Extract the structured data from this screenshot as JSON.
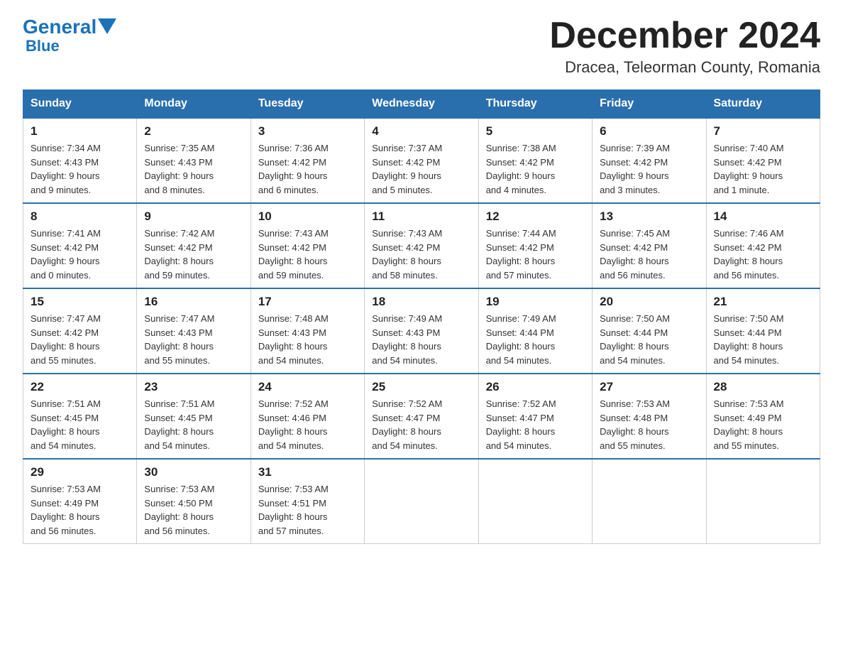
{
  "logo": {
    "general": "General",
    "blue": "Blue",
    "triangle": "▼"
  },
  "header": {
    "title": "December 2024",
    "subtitle": "Dracea, Teleorman County, Romania"
  },
  "days_of_week": [
    "Sunday",
    "Monday",
    "Tuesday",
    "Wednesday",
    "Thursday",
    "Friday",
    "Saturday"
  ],
  "weeks": [
    [
      {
        "day": "1",
        "sunrise": "7:34 AM",
        "sunset": "4:43 PM",
        "daylight": "9 hours and 9 minutes."
      },
      {
        "day": "2",
        "sunrise": "7:35 AM",
        "sunset": "4:43 PM",
        "daylight": "9 hours and 8 minutes."
      },
      {
        "day": "3",
        "sunrise": "7:36 AM",
        "sunset": "4:42 PM",
        "daylight": "9 hours and 6 minutes."
      },
      {
        "day": "4",
        "sunrise": "7:37 AM",
        "sunset": "4:42 PM",
        "daylight": "9 hours and 5 minutes."
      },
      {
        "day": "5",
        "sunrise": "7:38 AM",
        "sunset": "4:42 PM",
        "daylight": "9 hours and 4 minutes."
      },
      {
        "day": "6",
        "sunrise": "7:39 AM",
        "sunset": "4:42 PM",
        "daylight": "9 hours and 3 minutes."
      },
      {
        "day": "7",
        "sunrise": "7:40 AM",
        "sunset": "4:42 PM",
        "daylight": "9 hours and 1 minute."
      }
    ],
    [
      {
        "day": "8",
        "sunrise": "7:41 AM",
        "sunset": "4:42 PM",
        "daylight": "9 hours and 0 minutes."
      },
      {
        "day": "9",
        "sunrise": "7:42 AM",
        "sunset": "4:42 PM",
        "daylight": "8 hours and 59 minutes."
      },
      {
        "day": "10",
        "sunrise": "7:43 AM",
        "sunset": "4:42 PM",
        "daylight": "8 hours and 59 minutes."
      },
      {
        "day": "11",
        "sunrise": "7:43 AM",
        "sunset": "4:42 PM",
        "daylight": "8 hours and 58 minutes."
      },
      {
        "day": "12",
        "sunrise": "7:44 AM",
        "sunset": "4:42 PM",
        "daylight": "8 hours and 57 minutes."
      },
      {
        "day": "13",
        "sunrise": "7:45 AM",
        "sunset": "4:42 PM",
        "daylight": "8 hours and 56 minutes."
      },
      {
        "day": "14",
        "sunrise": "7:46 AM",
        "sunset": "4:42 PM",
        "daylight": "8 hours and 56 minutes."
      }
    ],
    [
      {
        "day": "15",
        "sunrise": "7:47 AM",
        "sunset": "4:42 PM",
        "daylight": "8 hours and 55 minutes."
      },
      {
        "day": "16",
        "sunrise": "7:47 AM",
        "sunset": "4:43 PM",
        "daylight": "8 hours and 55 minutes."
      },
      {
        "day": "17",
        "sunrise": "7:48 AM",
        "sunset": "4:43 PM",
        "daylight": "8 hours and 54 minutes."
      },
      {
        "day": "18",
        "sunrise": "7:49 AM",
        "sunset": "4:43 PM",
        "daylight": "8 hours and 54 minutes."
      },
      {
        "day": "19",
        "sunrise": "7:49 AM",
        "sunset": "4:44 PM",
        "daylight": "8 hours and 54 minutes."
      },
      {
        "day": "20",
        "sunrise": "7:50 AM",
        "sunset": "4:44 PM",
        "daylight": "8 hours and 54 minutes."
      },
      {
        "day": "21",
        "sunrise": "7:50 AM",
        "sunset": "4:44 PM",
        "daylight": "8 hours and 54 minutes."
      }
    ],
    [
      {
        "day": "22",
        "sunrise": "7:51 AM",
        "sunset": "4:45 PM",
        "daylight": "8 hours and 54 minutes."
      },
      {
        "day": "23",
        "sunrise": "7:51 AM",
        "sunset": "4:45 PM",
        "daylight": "8 hours and 54 minutes."
      },
      {
        "day": "24",
        "sunrise": "7:52 AM",
        "sunset": "4:46 PM",
        "daylight": "8 hours and 54 minutes."
      },
      {
        "day": "25",
        "sunrise": "7:52 AM",
        "sunset": "4:47 PM",
        "daylight": "8 hours and 54 minutes."
      },
      {
        "day": "26",
        "sunrise": "7:52 AM",
        "sunset": "4:47 PM",
        "daylight": "8 hours and 54 minutes."
      },
      {
        "day": "27",
        "sunrise": "7:53 AM",
        "sunset": "4:48 PM",
        "daylight": "8 hours and 55 minutes."
      },
      {
        "day": "28",
        "sunrise": "7:53 AM",
        "sunset": "4:49 PM",
        "daylight": "8 hours and 55 minutes."
      }
    ],
    [
      {
        "day": "29",
        "sunrise": "7:53 AM",
        "sunset": "4:49 PM",
        "daylight": "8 hours and 56 minutes."
      },
      {
        "day": "30",
        "sunrise": "7:53 AM",
        "sunset": "4:50 PM",
        "daylight": "8 hours and 56 minutes."
      },
      {
        "day": "31",
        "sunrise": "7:53 AM",
        "sunset": "4:51 PM",
        "daylight": "8 hours and 57 minutes."
      },
      null,
      null,
      null,
      null
    ]
  ],
  "labels": {
    "sunrise": "Sunrise:",
    "sunset": "Sunset:",
    "daylight": "Daylight:"
  }
}
